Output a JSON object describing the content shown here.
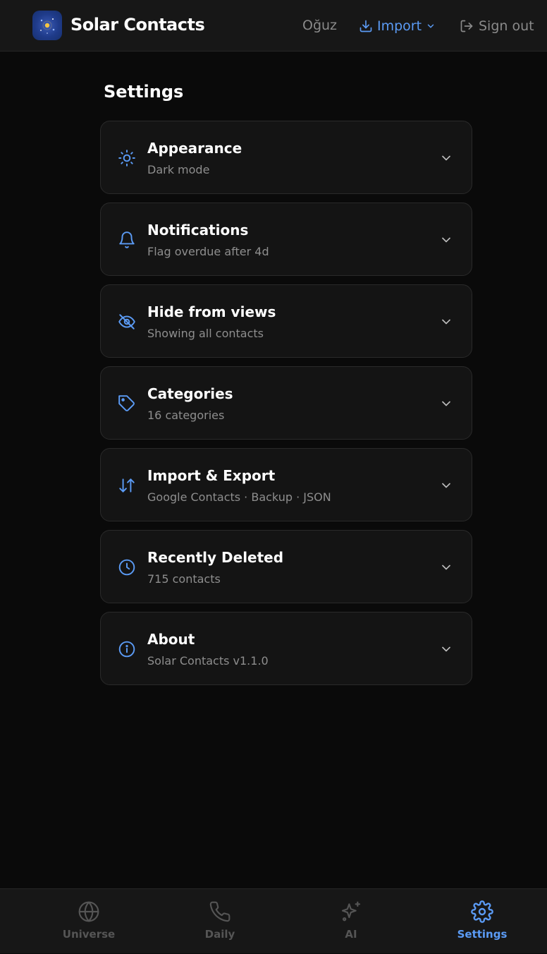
{
  "app": {
    "title": "Solar Contacts",
    "logo_icon": "solar-system-logo"
  },
  "header": {
    "user": "Oğuz",
    "import_label": "Import",
    "signout_label": "Sign out"
  },
  "page": {
    "title": "Settings"
  },
  "settings": [
    {
      "icon": "sun-icon",
      "title": "Appearance",
      "subtitle": "Dark mode"
    },
    {
      "icon": "bell-icon",
      "title": "Notifications",
      "subtitle": "Flag overdue after 4d"
    },
    {
      "icon": "eye-off-icon",
      "title": "Hide from views",
      "subtitle": "Showing all contacts"
    },
    {
      "icon": "tag-icon",
      "title": "Categories",
      "subtitle": "16 categories"
    },
    {
      "icon": "arrows-up-down-icon",
      "title": "Import & Export",
      "subtitle": "Google Contacts · Backup · JSON"
    },
    {
      "icon": "clock-icon",
      "title": "Recently Deleted",
      "subtitle": "715 contacts"
    },
    {
      "icon": "info-icon",
      "title": "About",
      "subtitle": "Solar Contacts v1.1.0"
    }
  ],
  "tabs": [
    {
      "icon": "globe-icon",
      "label": "Universe",
      "active": false
    },
    {
      "icon": "phone-icon",
      "label": "Daily",
      "active": false
    },
    {
      "icon": "sparkles-icon",
      "label": "AI",
      "active": false
    },
    {
      "icon": "gear-icon",
      "label": "Settings",
      "active": true
    }
  ],
  "colors": {
    "accent": "#5b9bf5",
    "background": "#0a0a0a",
    "card": "#141414",
    "bar": "#171717",
    "muted": "#8e8e8e",
    "inactive_tab": "#555555"
  }
}
